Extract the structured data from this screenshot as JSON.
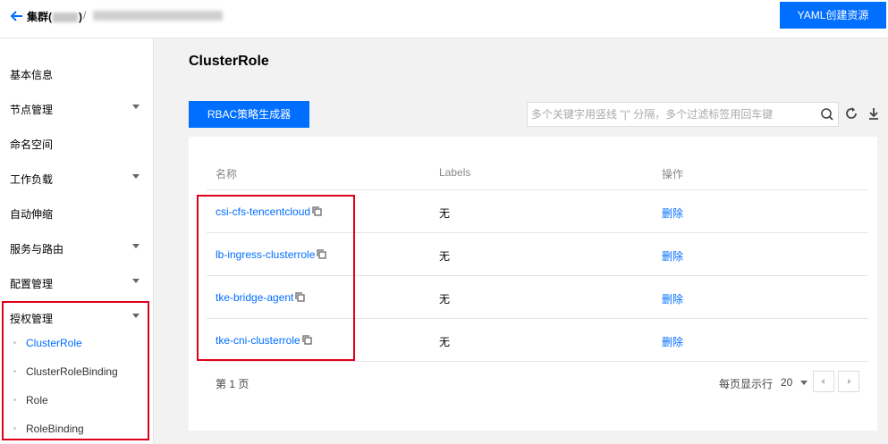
{
  "header": {
    "cluster_label": "集群(",
    "cluster_label_end": ")",
    "separator": "/",
    "yaml_button": "YAML创建资源"
  },
  "sidebar": {
    "items": [
      {
        "label": "基本信息"
      },
      {
        "label": "节点管理"
      },
      {
        "label": "命名空间"
      },
      {
        "label": "工作负载"
      },
      {
        "label": "自动伸缩"
      },
      {
        "label": "服务与路由"
      },
      {
        "label": "配置管理"
      },
      {
        "label": "授权管理"
      }
    ],
    "subitems": [
      {
        "label": "ClusterRole"
      },
      {
        "label": "ClusterRoleBinding"
      },
      {
        "label": "Role"
      },
      {
        "label": "RoleBinding"
      }
    ]
  },
  "main": {
    "title": "ClusterRole",
    "rbac_button": "RBAC策略生成器",
    "search_placeholder": "多个关键字用竖线 \"|\" 分隔，多个过滤标签用回车键"
  },
  "table": {
    "headers": [
      "名称",
      "Labels",
      "操作"
    ],
    "rows": [
      {
        "name": "csi-cfs-tencentcloud",
        "labels": "无",
        "action": "删除"
      },
      {
        "name": "lb-ingress-clusterrole",
        "labels": "无",
        "action": "删除"
      },
      {
        "name": "tke-bridge-agent",
        "labels": "无",
        "action": "删除"
      },
      {
        "name": "tke-cni-clusterrole",
        "labels": "无",
        "action": "删除"
      }
    ]
  },
  "pagination": {
    "page_text": "第 1 页",
    "per_page_label": "每页显示行",
    "per_page_value": "20"
  },
  "colors": {
    "accent": "#006eff",
    "highlight": "#e0001b"
  }
}
